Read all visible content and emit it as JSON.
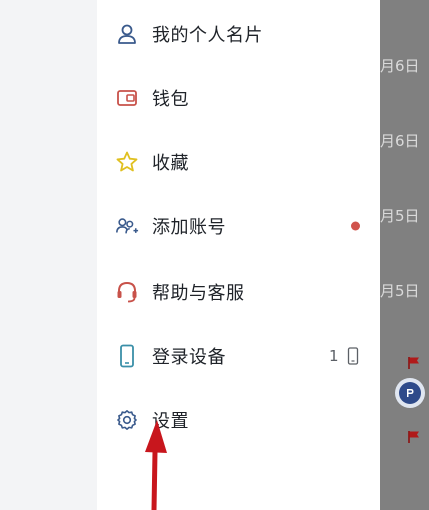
{
  "menu": {
    "items": [
      {
        "label": "我的个人名片",
        "icon": "user-card-icon"
      },
      {
        "label": "钱包",
        "icon": "wallet-icon"
      },
      {
        "label": "收藏",
        "icon": "star-icon"
      },
      {
        "label": "添加账号",
        "icon": "add-account-icon",
        "has_dot": true
      },
      {
        "label": "帮助与客服",
        "icon": "headset-icon"
      },
      {
        "label": "登录设备",
        "icon": "phone-icon",
        "count": "1"
      },
      {
        "label": "设置",
        "icon": "gear-icon"
      }
    ]
  },
  "background_list": {
    "dates": [
      "月6日",
      "月6日",
      "月5日",
      "月5日"
    ]
  },
  "colors": {
    "icon_blue": "#3a5a8c",
    "wallet_red": "#c8524a",
    "star_yellow": "#e0c020",
    "red_dot": "#d0534c",
    "flag_red": "#b01a1a",
    "arrow_red": "#c8161d"
  }
}
